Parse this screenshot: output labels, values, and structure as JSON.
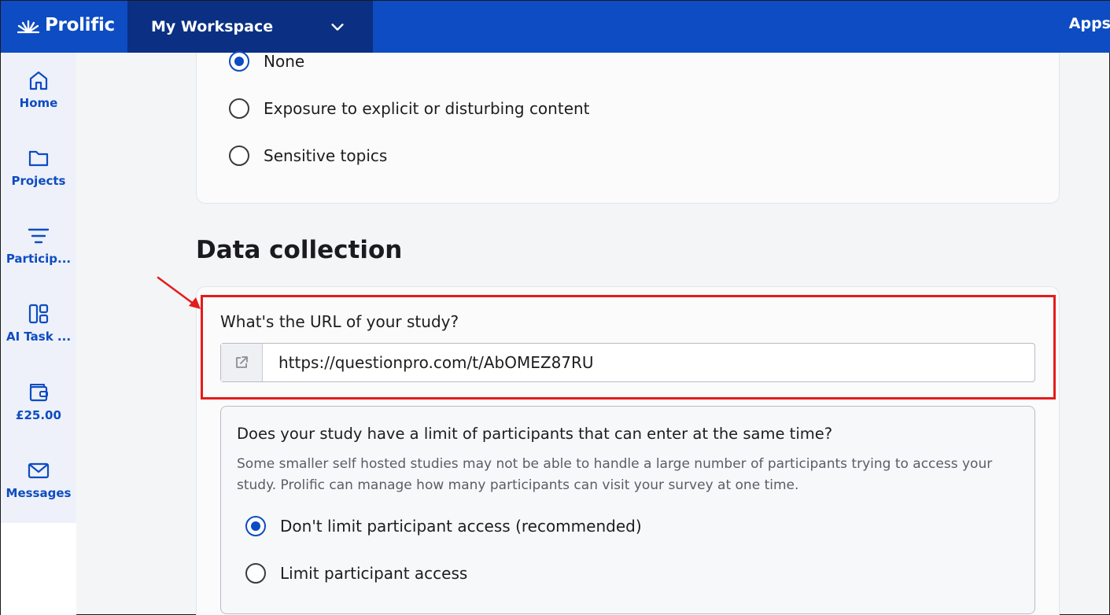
{
  "app": {
    "name": "Prolific"
  },
  "header": {
    "workspace_label": "My Workspace",
    "apps_label": "Apps"
  },
  "sidebar": {
    "items": [
      {
        "label": "Home",
        "icon": "home-icon"
      },
      {
        "label": "Projects",
        "icon": "folder-icon"
      },
      {
        "label": "Particip...",
        "icon": "filter-icon"
      },
      {
        "label": "AI Task ...",
        "icon": "layout-icon"
      },
      {
        "label": "£25.00",
        "icon": "wallet-icon"
      },
      {
        "label": "Messages",
        "icon": "mail-icon"
      }
    ]
  },
  "content_warning": {
    "options": [
      {
        "label": "None",
        "checked": true
      },
      {
        "label": "Exposure to explicit or disturbing content",
        "checked": false
      },
      {
        "label": "Sensitive topics",
        "checked": false
      }
    ]
  },
  "data_collection": {
    "title": "Data collection",
    "url_question": "What's the URL of your study?",
    "url_value": "https://questionpro.com/t/AbOMEZ87RU",
    "limit": {
      "question": "Does your study have a limit of participants that can enter at the same time?",
      "description": "Some smaller self hosted studies may not be able to handle a large number of participants trying to access your study. Prolific can manage how many participants can visit your survey at one time.",
      "options": [
        {
          "label": "Don't limit participant access (recommended)",
          "checked": true
        },
        {
          "label": "Limit participant access",
          "checked": false
        }
      ]
    }
  },
  "colors": {
    "brand_blue": "#0d4cc2",
    "workspace_navy": "#0a2f83",
    "highlight_red": "#e51b1b"
  }
}
